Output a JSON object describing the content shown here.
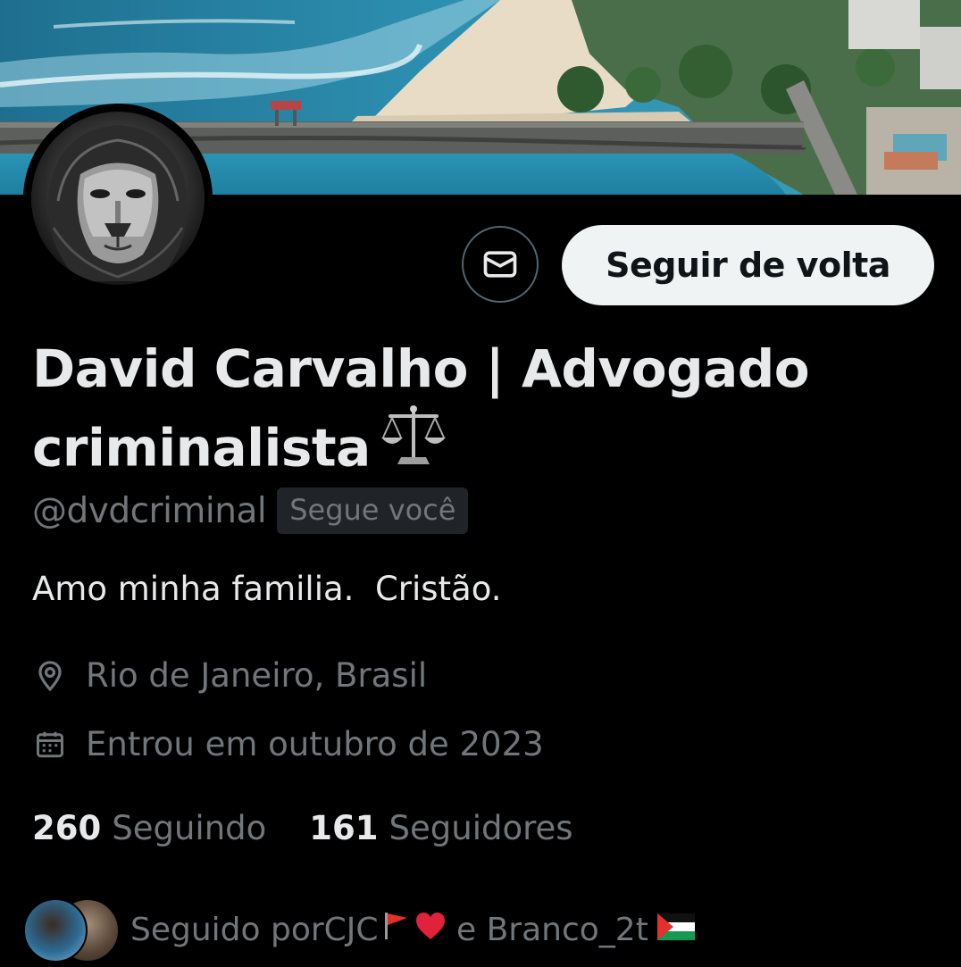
{
  "profile": {
    "display_name": "David Carvalho | Advogado criminalista",
    "name_emoji_icon": "balance-scale-icon",
    "handle": "@dvdcriminal",
    "follows_you_badge": "Segue você",
    "bio": "Amo minha familia.  Cristão.",
    "location": "Rio de Janeiro, Brasil",
    "joined": "Entrou em outubro de 2023"
  },
  "actions": {
    "message_icon": "envelope-icon",
    "follow_back_label": "Seguir de volta"
  },
  "stats": {
    "following_count": "260",
    "following_label": "Seguindo",
    "followers_count": "161",
    "followers_label": "Seguidores"
  },
  "followed_by": {
    "prefix": "Seguido por ",
    "user1": "CJC",
    "user1_emojis": [
      "red-flag-icon",
      "red-heart-icon"
    ],
    "connector": " e ",
    "user2": "Branco_2t",
    "user2_emojis": [
      "palestine-flag-icon"
    ]
  },
  "colors": {
    "background": "#000000",
    "primary_text": "#e7e9ea",
    "secondary_text": "#71767b",
    "button_bg": "#eff3f4",
    "badge_bg": "#202327"
  }
}
